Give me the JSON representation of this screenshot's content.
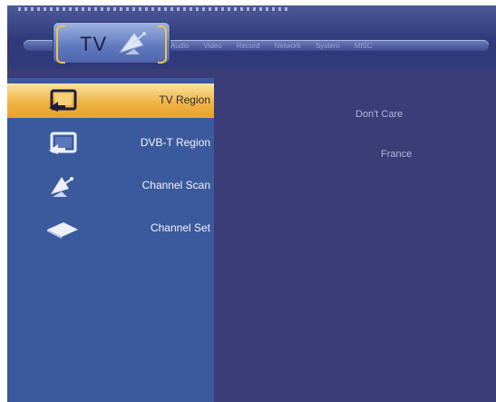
{
  "header": {
    "active_tab": "TV",
    "tabs": [
      "Audio",
      "Video",
      "Record",
      "Network",
      "System",
      "MISC"
    ]
  },
  "menu": {
    "items": [
      {
        "label": "TV Region",
        "value": "Don't Care",
        "icon": "tv-icon",
        "selected": true
      },
      {
        "label": "DVB-T Region",
        "value": "France",
        "icon": "tv-icon",
        "selected": false
      },
      {
        "label": "Channel Scan",
        "value": "",
        "icon": "satellite-dish-icon",
        "selected": false
      },
      {
        "label": "Channel Set",
        "value": "",
        "icon": "channel-tile-icon",
        "selected": false
      }
    ]
  },
  "colors": {
    "background": "#3a3d77",
    "left_panel": "#3b5a9e",
    "highlight": "#f0b446",
    "accent": "#f2c04a"
  }
}
